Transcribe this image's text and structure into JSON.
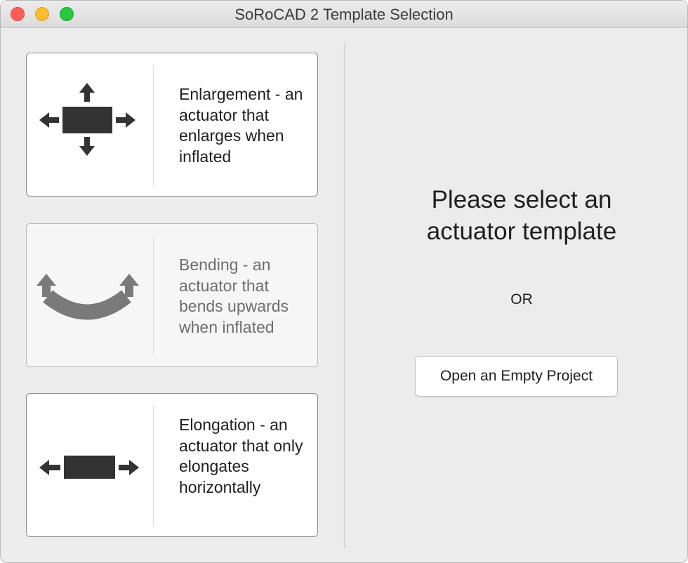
{
  "window": {
    "title": "SoRoCAD 2 Template Selection",
    "controls": [
      "close",
      "minimize",
      "zoom"
    ]
  },
  "templates": [
    {
      "id": "enlargement",
      "label": "Enlargement - an actuator that enlarges when inflated",
      "icon": "enlarge-arrows-icon",
      "enabled": true
    },
    {
      "id": "bending",
      "label": "Bending - an actuator that bends upwards when inflated",
      "icon": "bending-arc-icon",
      "enabled": false
    },
    {
      "id": "elongation",
      "label": "Elongation - an actuator that only elongates horizontally",
      "icon": "horizontal-arrows-icon",
      "enabled": true
    }
  ],
  "right_panel": {
    "prompt": "Please select an actuator template",
    "or": "OR",
    "empty_project_button": "Open an Empty Project"
  },
  "colors": {
    "icon_dark": "#333333",
    "icon_disabled": "#7a7a7a",
    "close": "#ff5f57",
    "minimize": "#febc2e",
    "zoom": "#28c840"
  }
}
